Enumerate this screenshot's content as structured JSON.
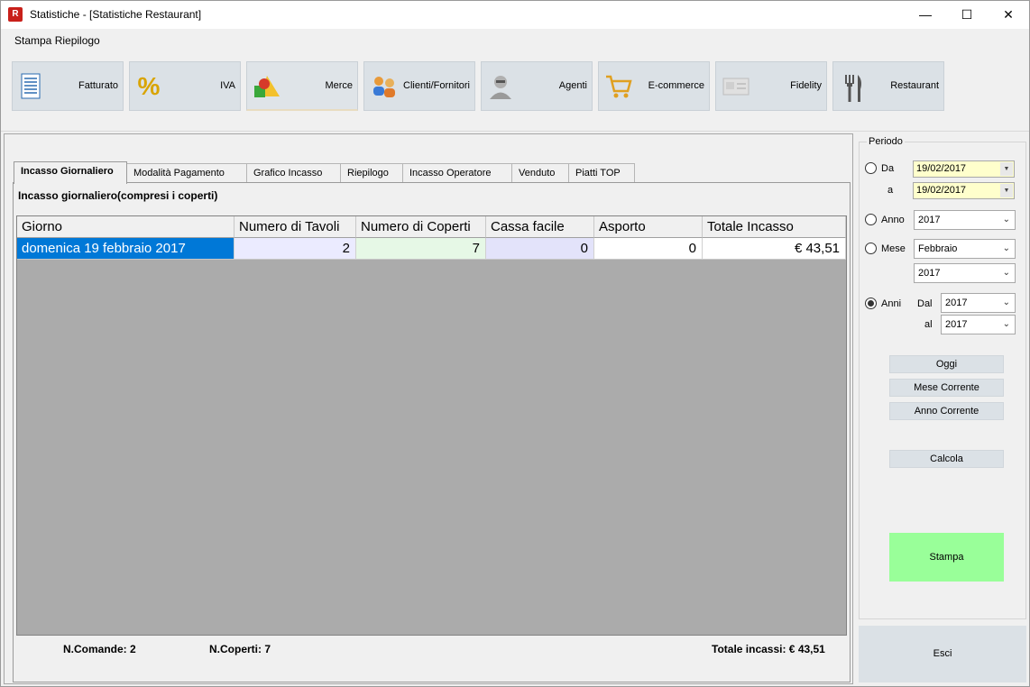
{
  "window": {
    "title": "Statistiche - [Statistiche Restaurant]",
    "app_icon_text": "R",
    "controls": {
      "minimize": "—",
      "maximize": "☐",
      "close": "✕"
    }
  },
  "menu": {
    "items": [
      {
        "label": "Stampa Riepilogo"
      }
    ]
  },
  "toolbar": {
    "buttons": [
      {
        "label": "Fatturato",
        "icon": "document-icon",
        "glyph": "📄"
      },
      {
        "label": "IVA",
        "icon": "percent-icon",
        "glyph": "%"
      },
      {
        "label": "Merce",
        "icon": "shapes-icon",
        "glyph": "🔺"
      },
      {
        "label": "Clienti/Fornitori",
        "icon": "people-icon",
        "glyph": "👥"
      },
      {
        "label": "Agenti",
        "icon": "agent-icon",
        "glyph": "🕴"
      },
      {
        "label": "E-commerce",
        "icon": "cart-icon",
        "glyph": "🛒"
      },
      {
        "label": "Fidelity",
        "icon": "card-icon",
        "glyph": "💳"
      },
      {
        "label": "Restaurant",
        "icon": "cutlery-icon",
        "glyph": "🍴"
      }
    ]
  },
  "tabs": [
    {
      "label": "Incasso Giornaliero",
      "active": true
    },
    {
      "label": "Modalità Pagamento"
    },
    {
      "label": "Grafico Incasso"
    },
    {
      "label": "Riepilogo"
    },
    {
      "label": "Incasso Operatore"
    },
    {
      "label": "Venduto"
    },
    {
      "label": "Piatti TOP"
    }
  ],
  "content": {
    "section_title": "Incasso giornaliero(compresi i coperti)",
    "table": {
      "columns": [
        "Giorno",
        "Numero di Tavoli",
        "Numero di Coperti",
        "Cassa facile",
        "Asporto",
        "Totale Incasso"
      ],
      "rows": [
        [
          "domenica 19 febbraio 2017",
          "2",
          "7",
          "0",
          "0",
          "€ 43,51"
        ]
      ]
    },
    "footer": {
      "comande": "N.Comande: 2",
      "coperti": "N.Coperti: 7",
      "totale": "Totale incassi: € 43,51"
    }
  },
  "periodo": {
    "title": "Periodo",
    "da_label": "Da",
    "da_value": "19/02/2017",
    "a_label": "a",
    "a_value": "19/02/2017",
    "anno_label": "Anno",
    "anno_value": "2017",
    "mese_label": "Mese",
    "mese_value": "Febbraio",
    "mese_anno_value": "2017",
    "anni_label": "Anni",
    "dal_label": "Dal",
    "dal_value": "2017",
    "al_label": "al",
    "al_value": "2017",
    "selected": "Anni",
    "oggi": "Oggi",
    "mese_corrente": "Mese Corrente",
    "anno_corrente": "Anno Corrente",
    "calcola": "Calcola",
    "stampa": "Stampa",
    "esci": "Esci"
  },
  "colors": {
    "selection": "#0078d7",
    "tavoli_cell": "#ebebff",
    "coperti_cell": "#e6f8e6",
    "cassa_cell": "#e3e3fa",
    "date_field": "#ffffcc",
    "stampa_button": "#99ff99"
  }
}
